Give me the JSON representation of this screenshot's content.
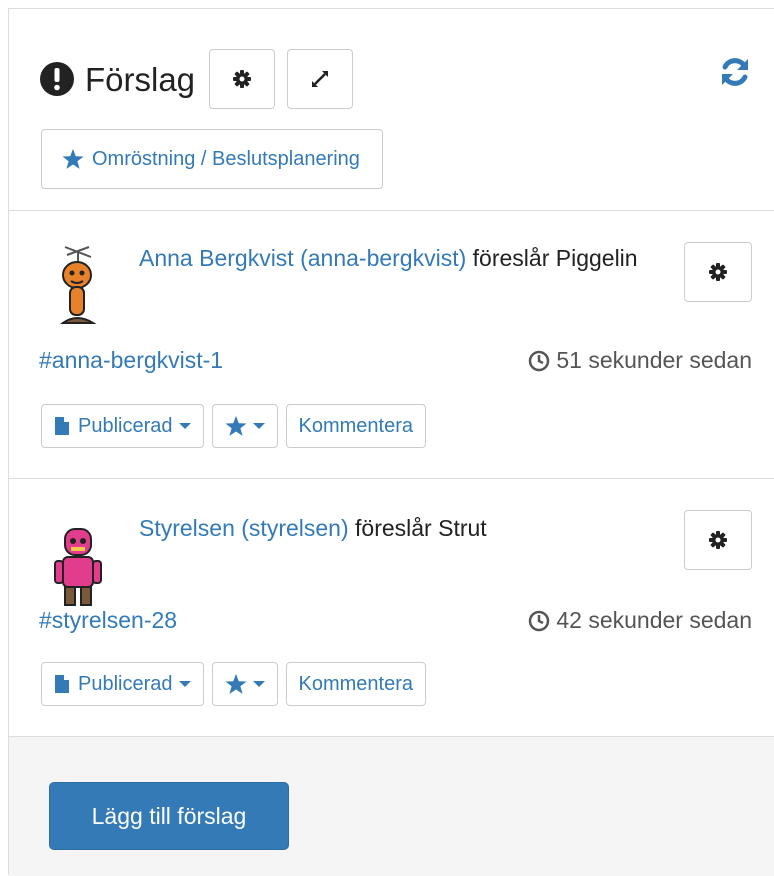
{
  "header": {
    "title": "Förslag",
    "vote_button_label": "Omröstning / Beslutsplanering"
  },
  "proposals": [
    {
      "user": "Anna Bergkvist (anna-bergkvist)",
      "verb": " föreslår ",
      "name": "Piggelin",
      "ref": "#anna-bergkvist-1",
      "time": "51 sekunder sedan",
      "status": "Publicerad",
      "comment": "Kommentera"
    },
    {
      "user": "Styrelsen (styrelsen)",
      "verb": " föreslår ",
      "name": "Strut",
      "ref": "#styrelsen-28",
      "time": "42 sekunder sedan",
      "status": "Publicerad",
      "comment": "Kommentera"
    }
  ],
  "footer": {
    "add_button_label": "Lägg till förslag"
  },
  "icons": {
    "title": "exclamation-circle-icon",
    "settings": "gear-icon",
    "expand": "expand-icon",
    "refresh": "refresh-icon",
    "vote": "star-icon",
    "time": "clock-icon",
    "status": "file-icon"
  },
  "colors": {
    "link": "#337ab7",
    "primary": "#337ab7",
    "footer_bg": "#f5f5f5"
  }
}
